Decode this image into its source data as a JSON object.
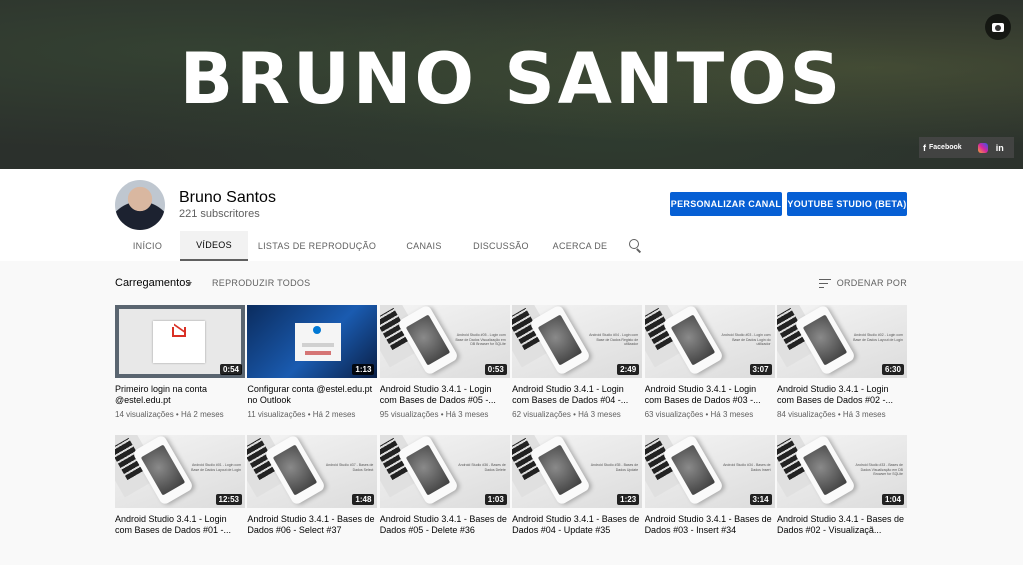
{
  "banner": {
    "title": "BRUNO SANTOS",
    "social": {
      "facebook": "Facebook",
      "facebook_icon": "f",
      "linkedin": "in"
    }
  },
  "channel": {
    "name": "Bruno Santos",
    "subscribers": "221 subscritores"
  },
  "buttons": {
    "customize": "PERSONALIZAR CANAL",
    "studio": "YOUTUBE STUDIO (BETA)"
  },
  "tabs": [
    "INÍCIO",
    "VÍDEOS",
    "LISTAS DE REPRODUÇÃO",
    "CANAIS",
    "DISCUSSÃO",
    "ACERCA DE"
  ],
  "toolbar": {
    "section": "Carregamentos",
    "play_all": "REPRODUZIR TODOS",
    "sort": "ORDENAR POR"
  },
  "videos": [
    {
      "title": "Primeiro login na conta @estel.edu.pt",
      "views": "14 visualizações",
      "age": "Há 2 meses",
      "duration": "0:54"
    },
    {
      "title": "Configurar conta @estel.edu.pt no Outlook",
      "views": "11 visualizações",
      "age": "Há 2 meses",
      "duration": "1:13"
    },
    {
      "title": "Android Studio 3.4.1 - Login com Bases de Dados #05 -...",
      "views": "95 visualizações",
      "age": "Há 3 meses",
      "duration": "0:53",
      "caption": "Android Studio #05 - Login com Base de Dados Visualização em DB Browser for SQLite"
    },
    {
      "title": "Android Studio 3.4.1 - Login com Bases de Dados #04 -...",
      "views": "62 visualizações",
      "age": "Há 3 meses",
      "duration": "2:49",
      "caption": "Android Studio #04 - Login com Base de Dados Registo de utilizador"
    },
    {
      "title": "Android Studio 3.4.1 - Login com Bases de Dados #03 -...",
      "views": "63 visualizações",
      "age": "Há 3 meses",
      "duration": "3:07",
      "caption": "Android Studio #03 - Login com Base de Dados Login do utilizador"
    },
    {
      "title": "Android Studio 3.4.1 - Login com Bases de Dados #02 -...",
      "views": "84 visualizações",
      "age": "Há 3 meses",
      "duration": "6:30",
      "caption": "Android Studio #02 - Login com Base de Dados Layout de Login"
    },
    {
      "title": "Android Studio 3.4.1 - Login com Bases de Dados #01 -...",
      "duration": "12:53",
      "caption": "Android Studio #01 - Login com Base de Dados Layout de Login"
    },
    {
      "title": "Android Studio 3.4.1 - Bases de Dados #06 - Select #37",
      "duration": "1:48",
      "caption": "Android Studio #37 - Bases de Dados Select"
    },
    {
      "title": "Android Studio 3.4.1 - Bases de Dados #05 - Delete #36",
      "duration": "1:03",
      "caption": "Android Studio #36 - Bases de Dados Delete"
    },
    {
      "title": "Android Studio 3.4.1 - Bases de Dados #04 - Update #35",
      "duration": "1:23",
      "caption": "Android Studio #35 - Bases de Dados Update"
    },
    {
      "title": "Android Studio 3.4.1 - Bases de Dados #03 - Insert #34",
      "duration": "3:14",
      "caption": "Android Studio #34 - Bases de Dados Insert"
    },
    {
      "title": "Android Studio 3.4.1 - Bases de Dados #02 - Visualizaçã...",
      "duration": "1:04",
      "caption": "Android Studio #33 - Bases de Dados Visualização em DB Browser for SQLite"
    }
  ]
}
